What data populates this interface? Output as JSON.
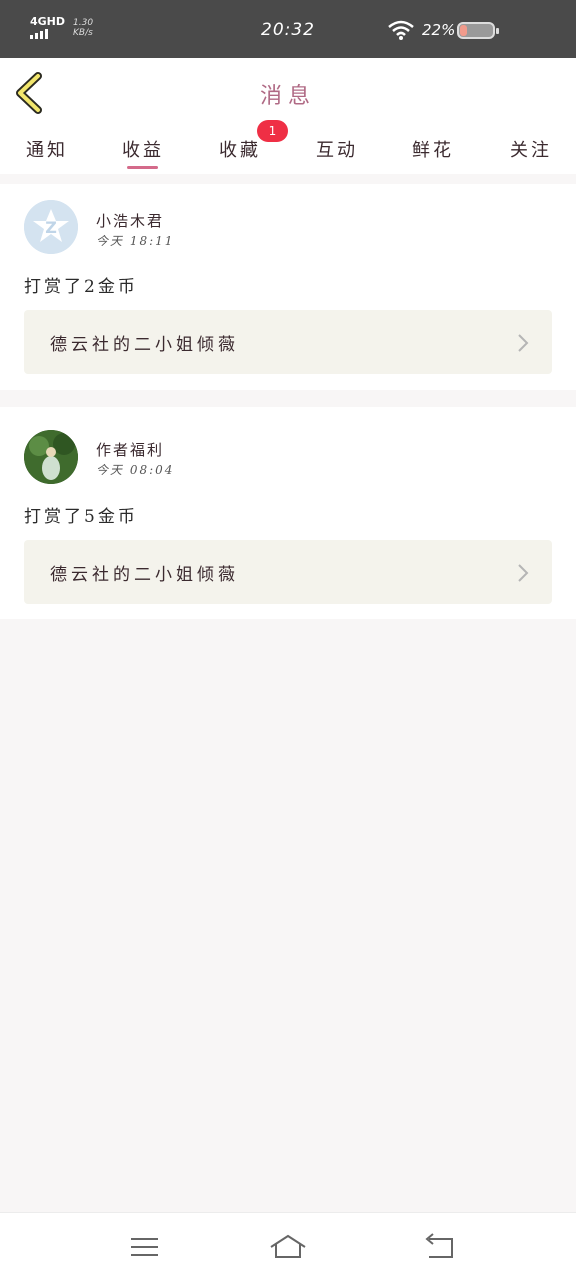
{
  "status_bar": {
    "network_type": "4GHD",
    "speed_value": "1.30",
    "speed_unit": "KB/s",
    "time": "20:32",
    "battery_percent": "22%",
    "battery_level": 0.22
  },
  "header": {
    "title": "消息",
    "back_icon": "chevron-left-icon"
  },
  "tabs": [
    {
      "label": "通知"
    },
    {
      "label": "收益",
      "active": true
    },
    {
      "label": "收藏",
      "badge": "1"
    },
    {
      "label": "互动"
    },
    {
      "label": "鲜花"
    },
    {
      "label": "关注"
    }
  ],
  "messages": [
    {
      "user": "小浩木君",
      "time": "今天 18:11",
      "action": "打赏了2金币",
      "book": "德云社的二小姐倾薇"
    },
    {
      "user": "作者福利",
      "time": "今天 08:04",
      "action": "打赏了5金币",
      "book": "德云社的二小姐倾薇"
    }
  ],
  "nav_bar": {
    "icons": [
      "menu-icon",
      "home-icon",
      "back-icon"
    ]
  },
  "colors": {
    "accent": "#d46a8a",
    "badge": "#ef2f45",
    "book_box": "#f4f3ec"
  }
}
